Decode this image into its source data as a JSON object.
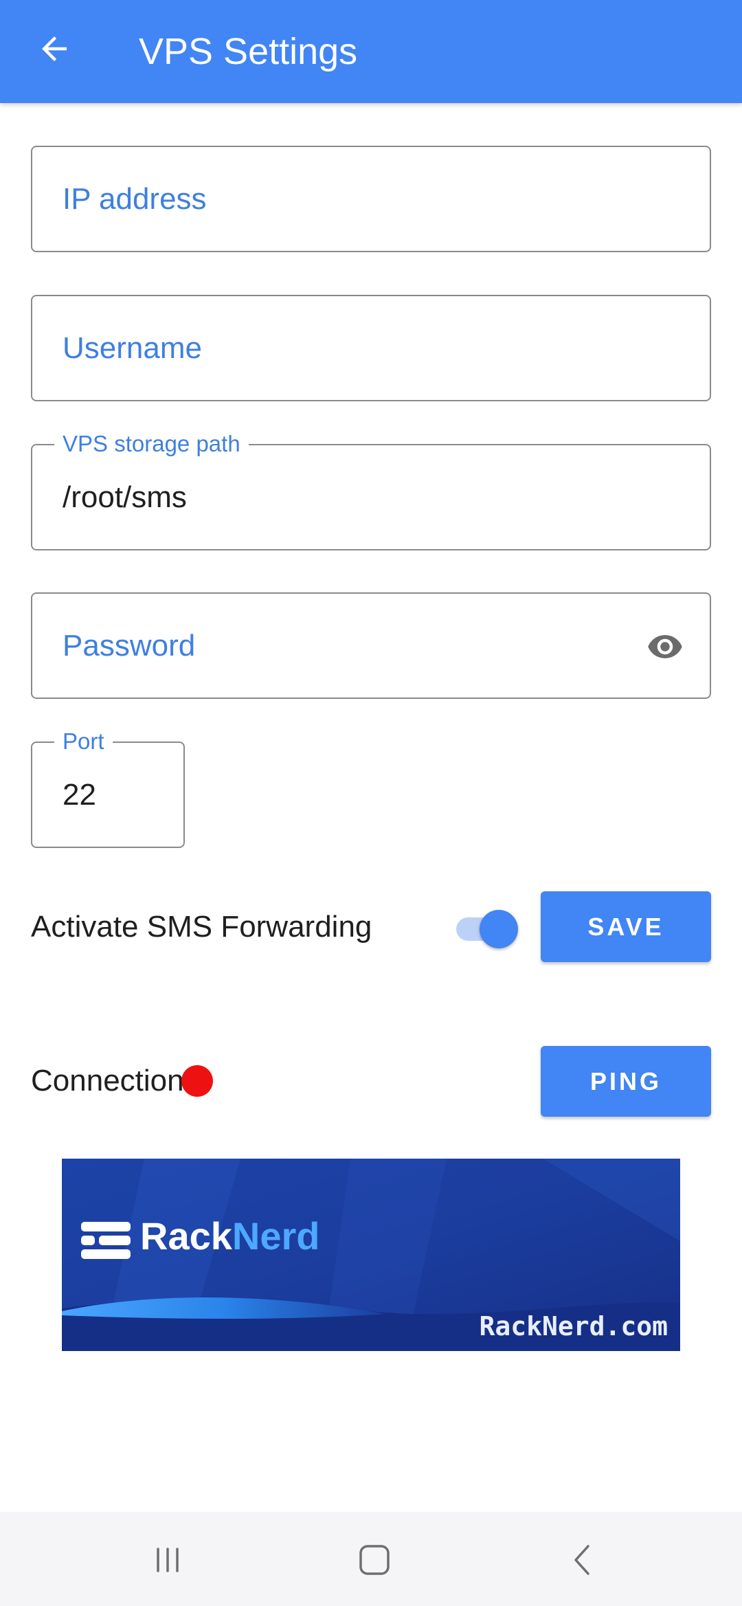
{
  "header": {
    "title": "VPS Settings"
  },
  "fields": {
    "ip": {
      "placeholder": "IP address"
    },
    "username": {
      "placeholder": "Username"
    },
    "storage": {
      "label": "VPS storage path",
      "value": "/root/sms"
    },
    "password": {
      "placeholder": "Password"
    },
    "port": {
      "label": "Port",
      "value": "22"
    }
  },
  "forwarding": {
    "label": "Activate SMS Forwarding",
    "enabled": true
  },
  "buttons": {
    "save": "SAVE",
    "ping": "PING"
  },
  "connection": {
    "label": "Connection",
    "status_color": "#ee1111"
  },
  "banner": {
    "brand_part1": "Rack",
    "brand_part2": "Nerd",
    "domain": "RackNerd.com"
  },
  "colors": {
    "accent": "#4285f4",
    "hint": "#3f7fe0"
  },
  "icons": {
    "back": "arrow-left-icon",
    "visibility": "eye-icon",
    "nav_recents": "recents-icon",
    "nav_home": "home-icon",
    "nav_back": "nav-back-icon"
  }
}
